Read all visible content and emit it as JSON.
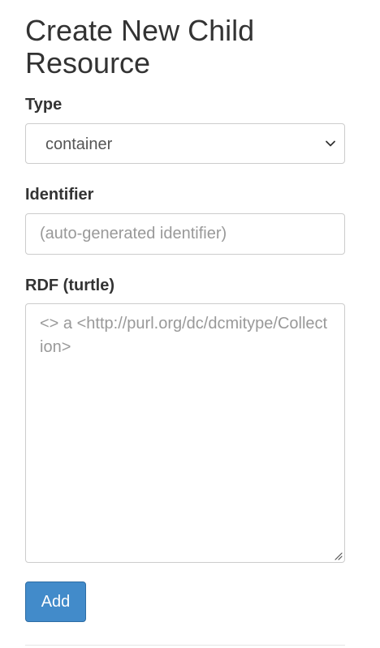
{
  "form": {
    "title": "Create New Child Resource",
    "type": {
      "label": "Type",
      "selected": "container"
    },
    "identifier": {
      "label": "Identifier",
      "value": "",
      "placeholder": "(auto-generated identifier)"
    },
    "rdf": {
      "label": "RDF (turtle)",
      "value": "",
      "placeholder": "<> a <http://purl.org/dc/dcmitype/Collection>"
    },
    "submit_label": "Add"
  },
  "colors": {
    "primary": "#428bca",
    "primary_border": "#2e6da4",
    "text": "#333333",
    "placeholder": "#999999",
    "border": "#cccccc"
  },
  "icons": {
    "select_arrow": "chevron-down-icon",
    "resize": "resize-grip-icon"
  }
}
